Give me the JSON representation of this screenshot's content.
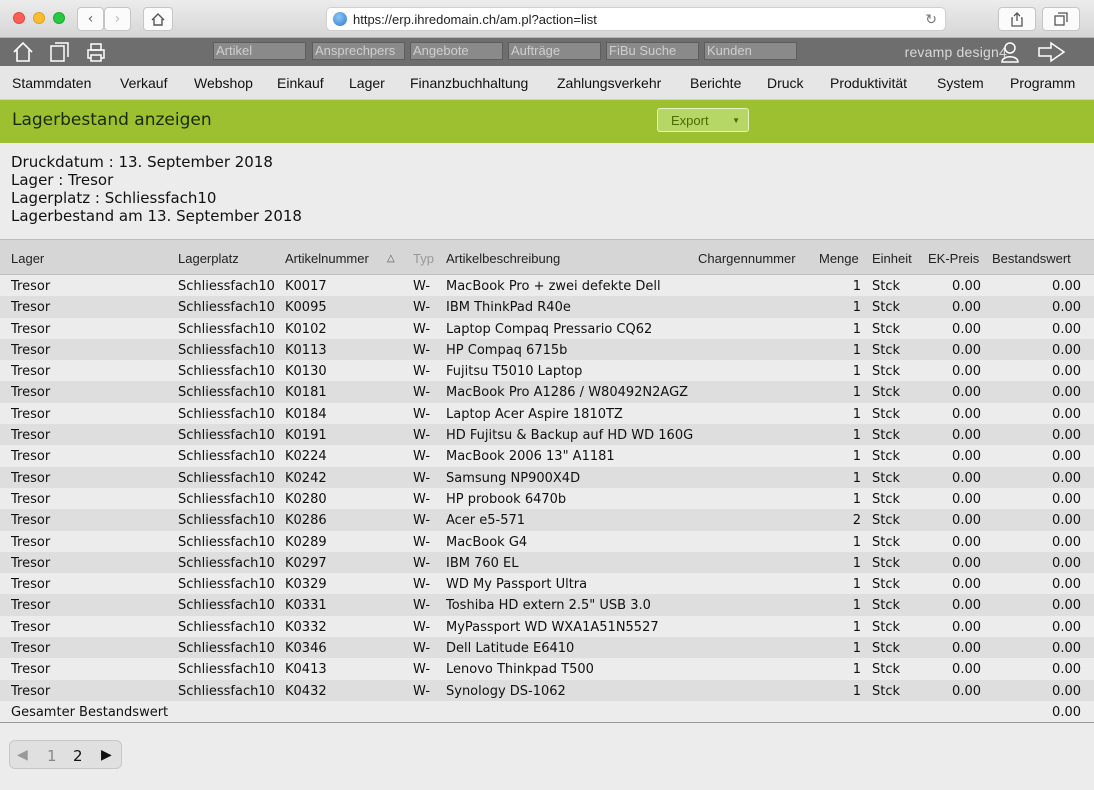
{
  "browser": {
    "url": "https://erp.ihredomain.ch/am.pl?action=list"
  },
  "topbar": {
    "quick_search": [
      "Artikel",
      "Ansprechpers",
      "Angebote",
      "Aufträge",
      "FiBu Suche",
      "Kunden"
    ],
    "brand": "revamp design4"
  },
  "menu": [
    "Stammdaten",
    "Verkauf",
    "Webshop",
    "Einkauf",
    "Lager",
    "Finanzbuchhaltung",
    "Zahlungsverkehr",
    "Berichte",
    "Druck",
    "Produktivität",
    "System",
    "Programm"
  ],
  "page": {
    "title": "Lagerbestand anzeigen",
    "export_label": "Export",
    "info": [
      "Druckdatum : 13. September 2018",
      "Lager : Tresor",
      "Lagerplatz : Schliessfach10",
      "Lagerbestand am 13. September 2018"
    ]
  },
  "table": {
    "headers": [
      "Lager",
      "Lagerplatz",
      "Artikelnummer",
      "Typ",
      "Artikelbeschreibung",
      "Chargennummer",
      "Menge",
      "Einheit",
      "EK-Preis",
      "Bestandswert"
    ],
    "sort_indicator": "△",
    "rows": [
      [
        "Tresor",
        "Schliessfach10",
        "K0017",
        "W-",
        "MacBook Pro + zwei defekte Dell",
        "",
        "1",
        "Stck",
        "0.00",
        "0.00"
      ],
      [
        "Tresor",
        "Schliessfach10",
        "K0095",
        "W-",
        "IBM ThinkPad R40e",
        "",
        "1",
        "Stck",
        "0.00",
        "0.00"
      ],
      [
        "Tresor",
        "Schliessfach10",
        "K0102",
        "W-",
        "Laptop Compaq Pressario CQ62",
        "",
        "1",
        "Stck",
        "0.00",
        "0.00"
      ],
      [
        "Tresor",
        "Schliessfach10",
        "K0113",
        "W-",
        "HP Compaq 6715b",
        "",
        "1",
        "Stck",
        "0.00",
        "0.00"
      ],
      [
        "Tresor",
        "Schliessfach10",
        "K0130",
        "W-",
        "Fujitsu T5010 Laptop",
        "",
        "1",
        "Stck",
        "0.00",
        "0.00"
      ],
      [
        "Tresor",
        "Schliessfach10",
        "K0181",
        "W-",
        "MacBook Pro A1286 / W80492N2AGZ",
        "",
        "1",
        "Stck",
        "0.00",
        "0.00"
      ],
      [
        "Tresor",
        "Schliessfach10",
        "K0184",
        "W-",
        "Laptop Acer Aspire 1810TZ",
        "",
        "1",
        "Stck",
        "0.00",
        "0.00"
      ],
      [
        "Tresor",
        "Schliessfach10",
        "K0191",
        "W-",
        "HD Fujitsu & Backup auf HD WD 160G",
        "",
        "1",
        "Stck",
        "0.00",
        "0.00"
      ],
      [
        "Tresor",
        "Schliessfach10",
        "K0224",
        "W-",
        "MacBook 2006 13\" A1181",
        "",
        "1",
        "Stck",
        "0.00",
        "0.00"
      ],
      [
        "Tresor",
        "Schliessfach10",
        "K0242",
        "W-",
        "Samsung NP900X4D",
        "",
        "1",
        "Stck",
        "0.00",
        "0.00"
      ],
      [
        "Tresor",
        "Schliessfach10",
        "K0280",
        "W-",
        "HP probook 6470b",
        "",
        "1",
        "Stck",
        "0.00",
        "0.00"
      ],
      [
        "Tresor",
        "Schliessfach10",
        "K0286",
        "W-",
        "Acer e5-571",
        "",
        "2",
        "Stck",
        "0.00",
        "0.00"
      ],
      [
        "Tresor",
        "Schliessfach10",
        "K0289",
        "W-",
        "MacBook G4",
        "",
        "1",
        "Stck",
        "0.00",
        "0.00"
      ],
      [
        "Tresor",
        "Schliessfach10",
        "K0297",
        "W-",
        "IBM 760 EL",
        "",
        "1",
        "Stck",
        "0.00",
        "0.00"
      ],
      [
        "Tresor",
        "Schliessfach10",
        "K0329",
        "W-",
        "WD My Passport Ultra",
        "",
        "1",
        "Stck",
        "0.00",
        "0.00"
      ],
      [
        "Tresor",
        "Schliessfach10",
        "K0331",
        "W-",
        "Toshiba HD extern 2.5\" USB 3.0",
        "",
        "1",
        "Stck",
        "0.00",
        "0.00"
      ],
      [
        "Tresor",
        "Schliessfach10",
        "K0332",
        "W-",
        "MyPassport WD WXA1A51N5527",
        "",
        "1",
        "Stck",
        "0.00",
        "0.00"
      ],
      [
        "Tresor",
        "Schliessfach10",
        "K0346",
        "W-",
        "Dell Latitude E6410",
        "",
        "1",
        "Stck",
        "0.00",
        "0.00"
      ],
      [
        "Tresor",
        "Schliessfach10",
        "K0413",
        "W-",
        "Lenovo Thinkpad T500",
        "",
        "1",
        "Stck",
        "0.00",
        "0.00"
      ],
      [
        "Tresor",
        "Schliessfach10",
        "K0432",
        "W-",
        "Synology DS-1062",
        "",
        "1",
        "Stck",
        "0.00",
        "0.00"
      ]
    ],
    "total_label": "Gesamter Bestandswert",
    "total_value": "0.00"
  },
  "pager": {
    "pages": [
      "1",
      "2"
    ],
    "current": "2"
  }
}
